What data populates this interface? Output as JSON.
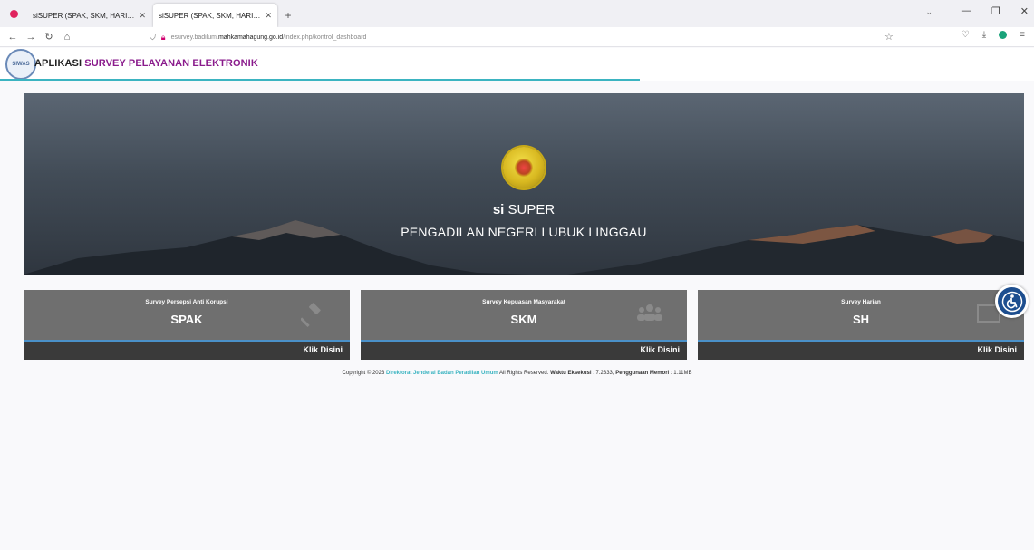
{
  "browser": {
    "tabs": [
      {
        "title": "siSUPER (SPAK, SKM, HARIAN) | Das",
        "active": false
      },
      {
        "title": "siSUPER (SPAK, SKM, HARIAN) | PEI",
        "active": true
      }
    ],
    "new_tab": "+",
    "url_host": "esurvey.badilum.mahkamahagung.go.id",
    "url_prefix": "esurvey.badilum.",
    "url_domain": "mahkamahagung.go.id",
    "url_path": "/index.php/kontrol_dashboard"
  },
  "header": {
    "logo_text": "SIWAS",
    "title_prefix": "APLIKASI ",
    "title_accent": "SURVEY PELAYANAN ELEKTRONIK"
  },
  "hero": {
    "title_strong": "si",
    "title_rest": " SUPER",
    "subtitle": "PENGADILAN NEGERI LUBUK LINGGAU"
  },
  "cards": [
    {
      "subtitle": "Survey Persepsi Anti Korupsi",
      "title": "SPAK",
      "link": "Klik Disini",
      "icon": "gavel-icon"
    },
    {
      "subtitle": "Survey Kepuasan Masyarakat",
      "title": "SKM",
      "link": "Klik Disini",
      "icon": "users-icon"
    },
    {
      "subtitle": "Survey Harian",
      "title": "SH",
      "link": "Klik Disini",
      "icon": "chart-icon"
    }
  ],
  "footer": {
    "prefix": "Copyright © 2023 ",
    "link": "Direktorat Jenderal Badan Peradilan Umum",
    "rights": " All Rights Reserved. ",
    "exec_label": "Waktu Eksekusi",
    "exec_value": " : 7.2333, ",
    "mem_label": "Penggunaan Memori",
    "mem_value": " : 1.11MB"
  },
  "colors": {
    "accent": "#8a1b8c",
    "link": "#3bb4c1",
    "card": "#6f6f6f",
    "card_footer": "#3a3a3a"
  }
}
